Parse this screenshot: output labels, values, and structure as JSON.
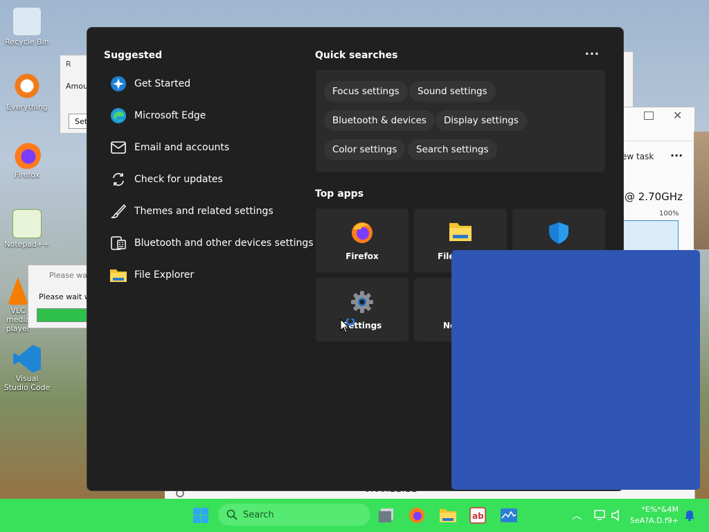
{
  "desktop": {
    "icons": [
      {
        "label": "Recycle Bin"
      },
      {
        "label": "Everything"
      },
      {
        "label": "Firefox"
      },
      {
        "label": "Notepad++"
      },
      {
        "label": "VLC media player"
      },
      {
        "label": "Visual Studio Code"
      }
    ]
  },
  "background_windows": {
    "dialog1_fragment": "Amour",
    "dialog1_button": "Set",
    "dialog1_title": "R",
    "wait_title": "Please wai",
    "wait_text": "Please wait wh",
    "taskmgr_new_task": "ew task",
    "taskmgr_cpu": "@ 2.70GHz",
    "taskmgr_pct": "100%",
    "taskmgr_time": "0:00:11:11"
  },
  "start_menu": {
    "suggested_title": "Suggested",
    "suggested": [
      {
        "label": "Get Started",
        "icon": "get-started-icon"
      },
      {
        "label": "Microsoft Edge",
        "icon": "edge-icon"
      },
      {
        "label": "Email and accounts",
        "icon": "mail-icon"
      },
      {
        "label": "Check for updates",
        "icon": "refresh-icon"
      },
      {
        "label": "Themes and related settings",
        "icon": "brush-icon"
      },
      {
        "label": "Bluetooth and other devices settings",
        "icon": "keyboard-icon"
      },
      {
        "label": "File Explorer",
        "icon": "folder-icon"
      }
    ],
    "quick_searches_title": "Quick searches",
    "more_label": "···",
    "quick_searches": [
      "Focus settings",
      "Sound settings",
      "Bluetooth & devices",
      "Display settings",
      "Color settings",
      "Search settings"
    ],
    "top_apps_title": "Top apps",
    "top_apps": [
      {
        "label": "Firefox"
      },
      {
        "label": "File"
      },
      {
        "label": ""
      },
      {
        "label": "Settings"
      },
      {
        "label": "No"
      }
    ]
  },
  "taskbar": {
    "search_placeholder": "Search",
    "clock_line1": "*E%*&4M",
    "clock_line2": "SeA?A.D.f9+"
  },
  "colors": {
    "taskbar": "#39e05a",
    "start_bg": "#202020",
    "overlay": "#2f55b5"
  }
}
